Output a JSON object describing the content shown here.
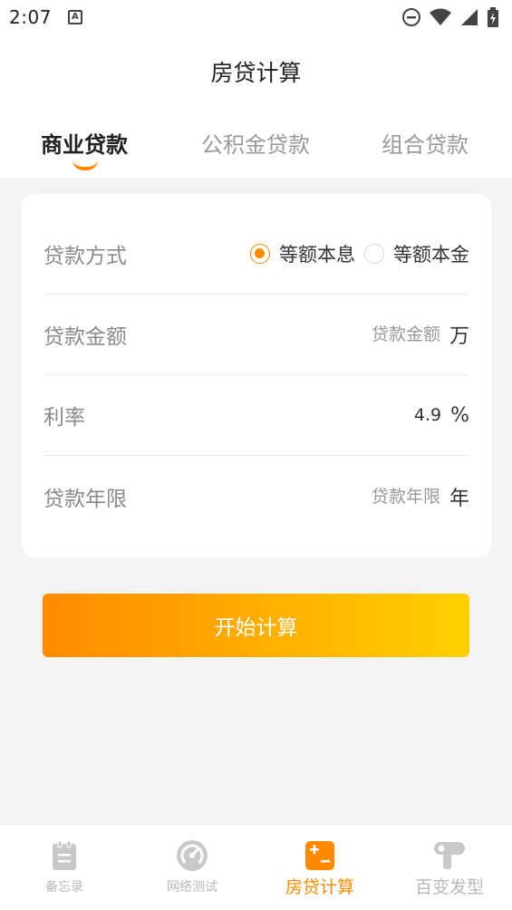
{
  "status_bar": {
    "time": "2:07",
    "notification_glyph": "A"
  },
  "header": {
    "title": "房贷计算"
  },
  "tabs": [
    {
      "label": "商业贷款",
      "active": true
    },
    {
      "label": "公积金贷款",
      "active": false
    },
    {
      "label": "组合贷款",
      "active": false
    }
  ],
  "form": {
    "repayment_method": {
      "label": "贷款方式",
      "options": [
        {
          "label": "等额本息",
          "selected": true
        },
        {
          "label": "等额本金",
          "selected": false
        }
      ]
    },
    "loan_amount": {
      "label": "贷款金额",
      "placeholder": "贷款金额",
      "value": "",
      "unit": "万"
    },
    "interest_rate": {
      "label": "利率",
      "value": "4.9",
      "unit": "%"
    },
    "loan_term": {
      "label": "贷款年限",
      "placeholder": "贷款年限",
      "value": "",
      "unit": "年"
    }
  },
  "calculate_button": {
    "label": "开始计算"
  },
  "bottom_nav": [
    {
      "label": "备忘录",
      "icon": "memo-icon",
      "active": false
    },
    {
      "label": "网络测试",
      "icon": "speedometer-icon",
      "active": false
    },
    {
      "label": "房贷计算",
      "icon": "calculator-icon",
      "active": true
    },
    {
      "label": "百变发型",
      "icon": "hair-dryer-icon",
      "active": false
    }
  ],
  "colors": {
    "accent": "#ff8a00",
    "accent_end": "#ffd000",
    "inactive": "#b8b8b8",
    "background": "#f4f4f4"
  }
}
